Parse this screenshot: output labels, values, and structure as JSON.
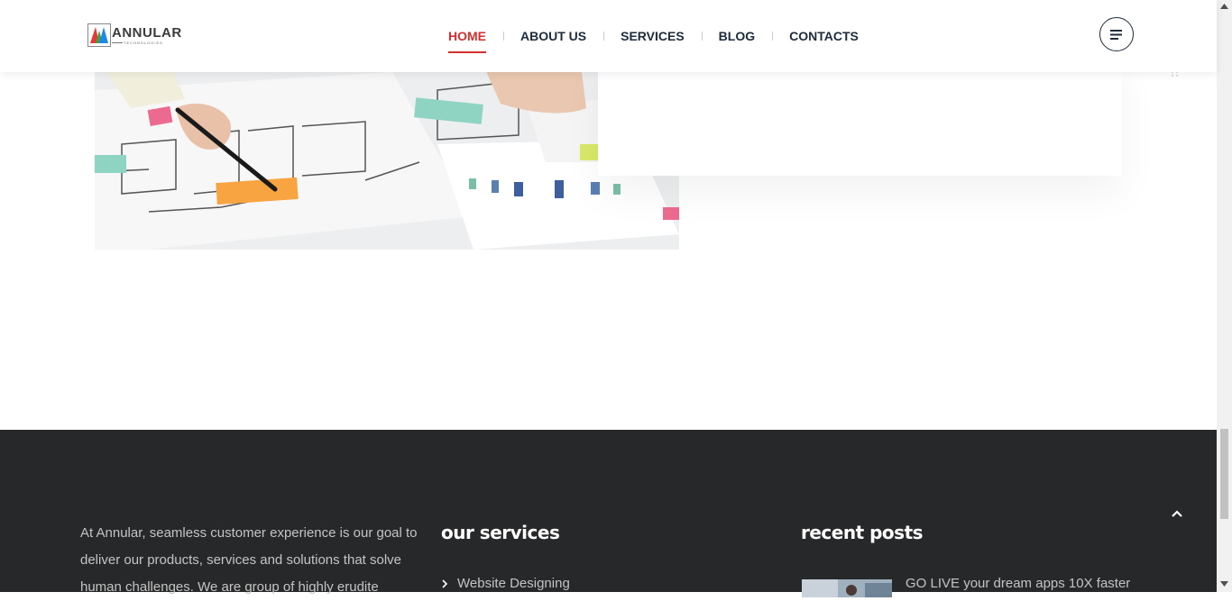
{
  "brand": {
    "name": "ANNULAR",
    "tagline": "TECHNOLOGIES",
    "colors": {
      "red": "#e53935",
      "green": "#43a047",
      "blue": "#1e88e5"
    }
  },
  "nav": {
    "items": [
      {
        "label": "HOME",
        "active": true
      },
      {
        "label": "ABOUT US",
        "active": false
      },
      {
        "label": "SERVICES",
        "active": false
      },
      {
        "label": "BLOG",
        "active": false
      },
      {
        "label": "CONTACTS",
        "active": false
      }
    ],
    "active_color": "#d32f2f",
    "menu_icon": "hamburger-icon"
  },
  "footer": {
    "background": "#27282a",
    "about_text": "At Annular, seamless customer experience is our goal to deliver our products, services and solutions that solve human challenges. We are group of highly erudite",
    "services_heading": "our services",
    "services": [
      "Website Designing"
    ],
    "posts_heading": "recent posts",
    "posts": [
      "GO LIVE your dream apps 10X faster"
    ],
    "back_to_top_icon": "chevron-up-icon"
  }
}
